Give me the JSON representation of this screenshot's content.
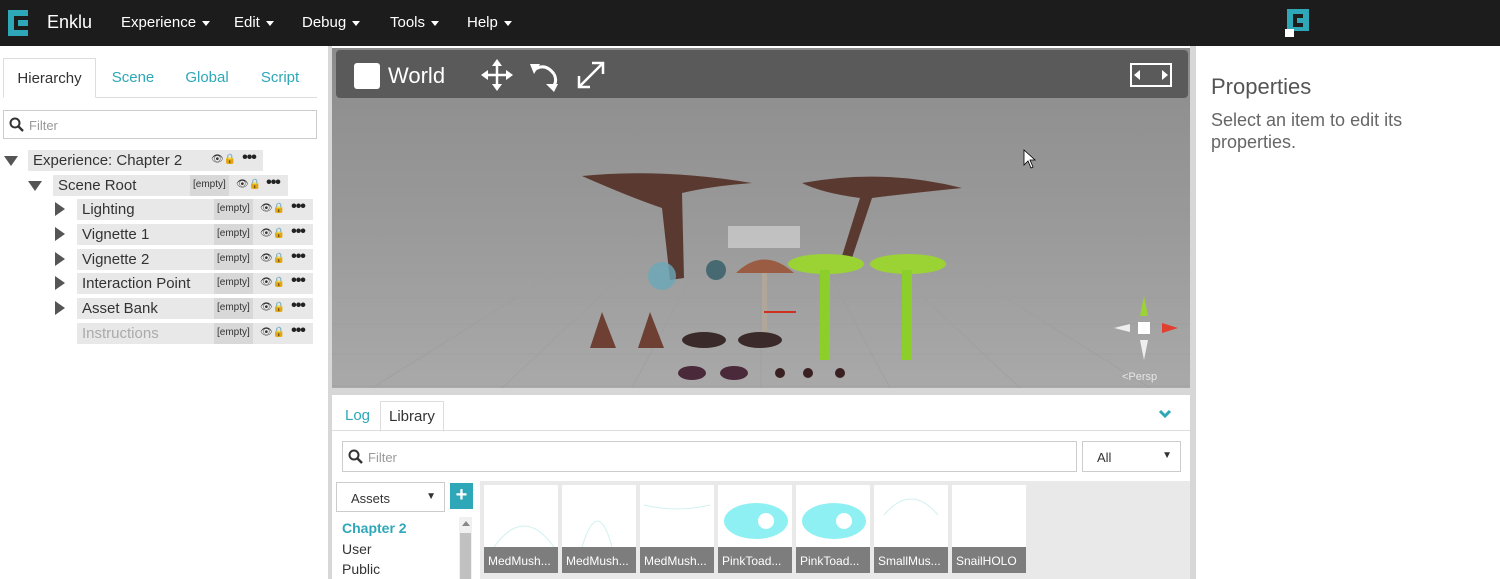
{
  "app": {
    "brand": "Enklu"
  },
  "menu": [
    {
      "label": "Experience"
    },
    {
      "label": "Edit"
    },
    {
      "label": "Debug"
    },
    {
      "label": "Tools"
    },
    {
      "label": "Help"
    }
  ],
  "left_tabs": [
    "Hierarchy",
    "Scene",
    "Global",
    "Script"
  ],
  "hierarchy_filter_placeholder": "Filter",
  "hierarchy": {
    "root": "Experience: Chapter 2",
    "scene_root": "Scene Root",
    "empty_tag": "[empty]",
    "more": "•••",
    "children": [
      "Lighting",
      "Vignette 1",
      "Vignette 2",
      "Interaction Point",
      "Asset Bank",
      "Instructions"
    ]
  },
  "viewport": {
    "space_label": "World",
    "camera_label": "<Persp"
  },
  "bottom_tabs": [
    "Log",
    "Library"
  ],
  "library": {
    "filter_placeholder": "Filter",
    "type_select": "All",
    "source_select": "Assets",
    "add_label": "+",
    "sources": [
      "Chapter 2",
      "User",
      "Public"
    ],
    "assets": [
      "MedMush...",
      "MedMush...",
      "MedMush...",
      "PinkToad...",
      "PinkToad...",
      "SmallMus...",
      "SnailHOLO"
    ]
  },
  "properties": {
    "title": "Properties",
    "description": "Select an item to edit its properties."
  },
  "colors": {
    "accent": "#2ea7b8",
    "topbar": "#1c1c1c",
    "viewport": "#8f8f8f"
  }
}
